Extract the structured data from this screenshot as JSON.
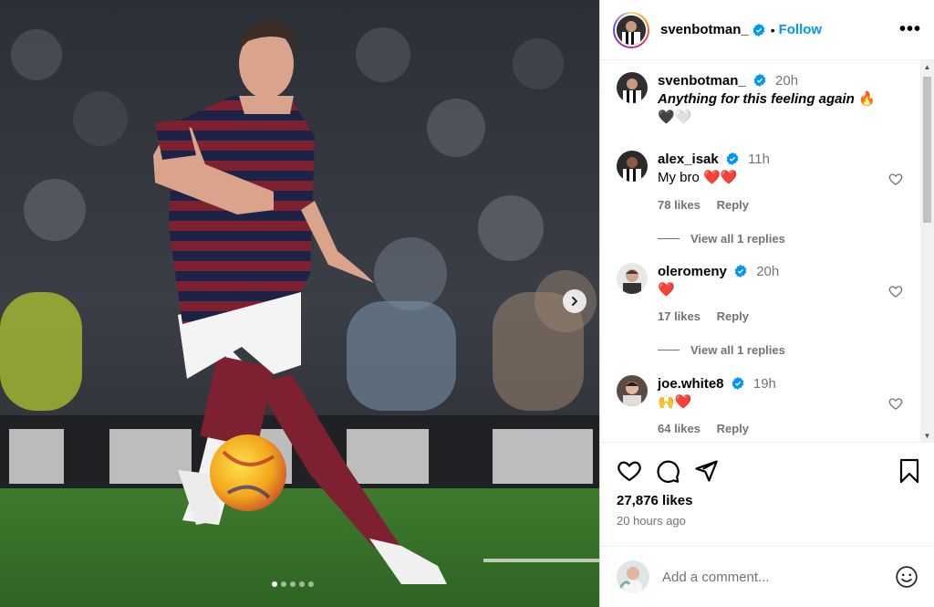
{
  "header": {
    "username": "svenbotman_",
    "verified": true,
    "separator": "•",
    "follow_label": "Follow",
    "more_label": "•••"
  },
  "caption": {
    "username": "svenbotman_",
    "time": "20h",
    "text": "Anything for this feeling again",
    "text_emoji": "🔥",
    "line2": "🖤🤍"
  },
  "comments": [
    {
      "username": "alex_isak",
      "time": "11h",
      "text": "My bro ❤️❤️",
      "likes": "78 likes",
      "reply_label": "Reply",
      "view_replies": "View all 1 replies"
    },
    {
      "username": "oleromeny",
      "time": "20h",
      "text": "❤️",
      "likes": "17 likes",
      "reply_label": "Reply",
      "view_replies": "View all 1 replies"
    },
    {
      "username": "joe.white8",
      "time": "19h",
      "text": "🙌❤️",
      "likes": "64 likes",
      "reply_label": "Reply"
    }
  ],
  "post": {
    "likes": "27,876 likes",
    "ago": "20 hours ago"
  },
  "add_comment": {
    "placeholder": "Add a comment..."
  },
  "carousel": {
    "total_slides": 5,
    "active_slide": 1
  },
  "colors": {
    "accent": "#0095f6",
    "verified": "#0095f6",
    "secondary_text": "#737373",
    "heart_red": "#ed4956"
  },
  "icons": [
    "verified-badge-icon",
    "heart-icon",
    "comment-icon",
    "share-icon",
    "bookmark-icon",
    "emoji-icon",
    "chevron-right-icon",
    "more-icon"
  ]
}
